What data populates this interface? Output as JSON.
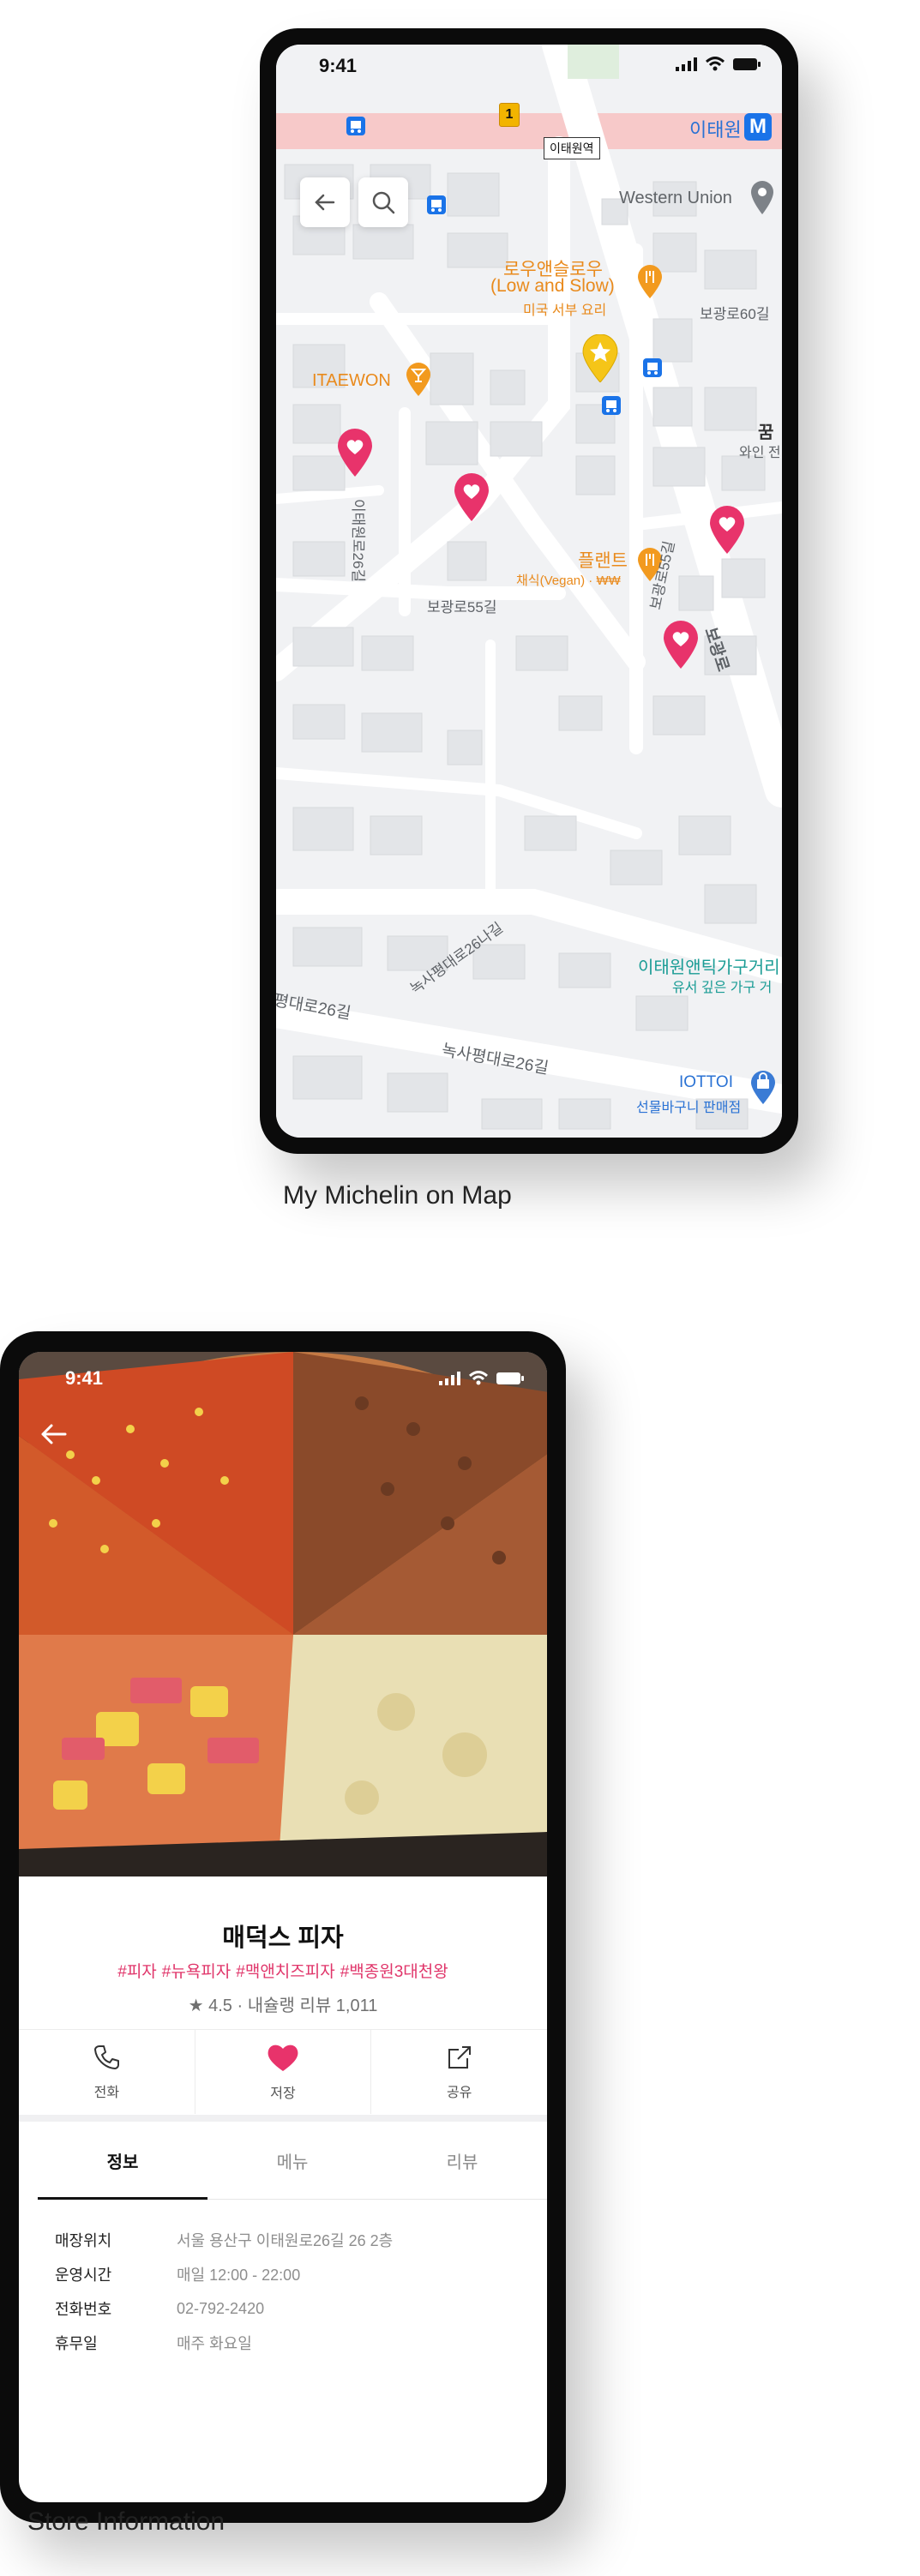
{
  "map_screen": {
    "status_time": "9:41",
    "station_label": "이태원역",
    "station_name": "이태원",
    "metro_badge": "M",
    "exit_badge": "1",
    "pois": {
      "western_union": "Western Union",
      "low_and_slow": "로우앤슬로우",
      "low_and_slow_en": "(Low and Slow)",
      "low_and_slow_sub": "미국 서부 요리",
      "itaewon": "ITAEWON",
      "plant": "플랜트",
      "plant_sub": "채식(Vegan) · ₩₩",
      "kkum_a": "꿈",
      "kkum_b": "와인 전",
      "antique": "이태원앤틱가구거리",
      "antique_sub": "유서 깊은 가구 거",
      "iottoi": "IOTTOI",
      "iottoi_sub": "선물바구니 판매점"
    },
    "roads": {
      "bogwang60": "보광로60길",
      "itaewon26": "이태원로26길",
      "bogwang55": "보광로55길",
      "bogwang55v": "보광로55길",
      "bogwangro": "보광로",
      "noksapyeong26na": "녹사평대로26나길",
      "noksapyeong26_left": "평대로26길",
      "noksapyeong26": "녹사평대로26길"
    },
    "icons": [
      "back-arrow-icon",
      "search-icon",
      "heart-pin-icon",
      "star-pin-icon",
      "restaurant-icon",
      "bar-icon",
      "bus-stop-icon",
      "shopping-bag-icon",
      "location-pin-icon"
    ],
    "colors": {
      "heart_pin": "#e8336b",
      "star_pin": "#f5c518",
      "poi_orange": "#e98a1c",
      "poi_teal": "#1a9c95",
      "metro_blue": "#1a73e8"
    }
  },
  "caption_map": "My Michelin on Map",
  "store_screen": {
    "status_time": "9:41",
    "store_name": "매덕스 피자",
    "tags": [
      "#피자",
      "#뉴욕피자",
      "#맥앤치즈피자",
      "#백종원3대천왕"
    ],
    "rating_text": "★ 4.5 · 내슐랭 리뷰 1,011",
    "actions": [
      {
        "label": "전화",
        "icon": "phone-icon"
      },
      {
        "label": "저장",
        "icon": "heart-icon"
      },
      {
        "label": "공유",
        "icon": "share-icon"
      }
    ],
    "tabs": [
      {
        "label": "정보",
        "active": true
      },
      {
        "label": "메뉴",
        "active": false
      },
      {
        "label": "리뷰",
        "active": false
      }
    ],
    "info": [
      {
        "key": "매장위치",
        "value": "서울 용산구 이태원로26길 26 2층"
      },
      {
        "key": "운영시간",
        "value": "매일 12:00 - 22:00"
      },
      {
        "key": "전화번호",
        "value": "02-792-2420"
      },
      {
        "key": "휴무일",
        "value": "매주 화요일"
      }
    ],
    "colors": {
      "tag": "#e0356a",
      "heart": "#e8336b"
    }
  },
  "caption_store": "Store Information"
}
